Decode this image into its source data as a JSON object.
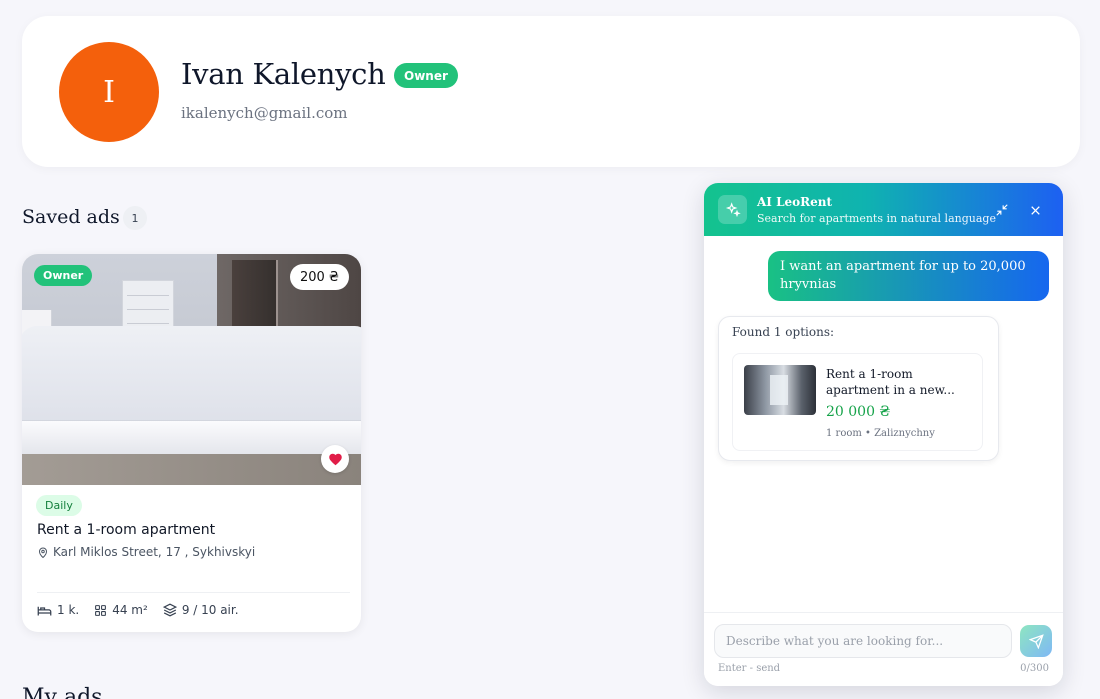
{
  "profile": {
    "avatar_initial": "I",
    "name": "Ivan Kalenych",
    "role_badge": "Owner",
    "email": "ikalenych@gmail.com",
    "avatar_color": "#f4600c"
  },
  "saved_ads": {
    "title": "Saved ads",
    "count": "1",
    "items": [
      {
        "owner_tag": "Owner",
        "price": "200 ₴",
        "type_tag": "Daily",
        "title": "Rent a 1-room apartment",
        "address": "Karl Miklos Street, 17 , Sykhivskyi",
        "rooms": "1 k.",
        "area": "44 m²",
        "floor": "9 / 10 air."
      }
    ]
  },
  "my_ads": {
    "title": "My ads"
  },
  "chat": {
    "title": "AI LeoRent",
    "subtitle": "Search for apartments in natural language",
    "user_message": "I want an apartment for up to 20,000 hryvnias",
    "bot_message": "Found 1 options:",
    "result": {
      "title": "Rent a 1-room apartment in a new...",
      "price": "20 000 ₴",
      "meta": "1 room • Zaliznychny"
    },
    "input_placeholder": "Describe what you are looking for...",
    "input_value": "",
    "hint": "Enter - send",
    "counter": "0/300"
  },
  "colors": {
    "accent_green": "#22c27a",
    "accent_blue": "#1d60f2",
    "price_green": "#16a34a",
    "heart_red": "#e11d48"
  }
}
